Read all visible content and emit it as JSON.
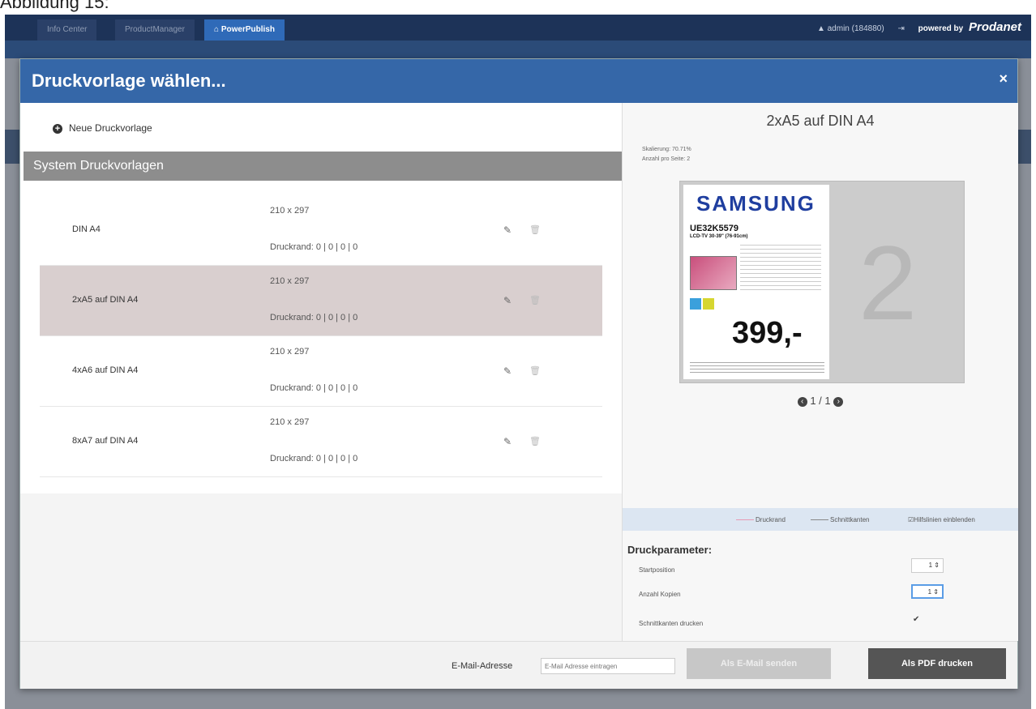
{
  "caption": "Abbildung 15:",
  "topbar": {
    "tabs": [
      {
        "label": "Info Center"
      },
      {
        "label": "ProductManager"
      },
      {
        "label": "PowerPublish"
      }
    ],
    "user": "admin (184880)",
    "powered_by": "powered by",
    "brand": "Prodanet"
  },
  "modal": {
    "title": "Druckvorlage wählen...",
    "close": "×",
    "new_template": "Neue Druckvorlage",
    "section_title": "System Druckvorlagen",
    "templates": [
      {
        "name": "DIN A4",
        "dimensions": "210 x 297",
        "margin": "Druckrand: 0 | 0 | 0 | 0"
      },
      {
        "name": "2xA5 auf DIN A4",
        "dimensions": "210 x 297",
        "margin": "Druckrand: 0 | 0 | 0 | 0"
      },
      {
        "name": "4xA6 auf DIN A4",
        "dimensions": "210 x 297",
        "margin": "Druckrand: 0 | 0 | 0 | 0"
      },
      {
        "name": "8xA7 auf DIN A4",
        "dimensions": "210 x 297",
        "margin": "Druckrand: 0 | 0 | 0 | 0"
      }
    ],
    "selected_index": 1
  },
  "preview": {
    "title": "2xA5 auf DIN A4",
    "scale": "Skalierung: 70.71%",
    "per_page": "Anzahl pro Seite: 2",
    "product": {
      "brand": "SAMSUNG",
      "model": "UE32K5579",
      "subtitle": "LCD-TV 30-39\" (76-91cm)",
      "price": "399,-"
    },
    "page_number": "2",
    "pager": "1 / 1"
  },
  "legend": {
    "print_margin": "Druckrand",
    "cut_marks": "Schnittkanten",
    "show_guides": "Hilfslinien einblenden"
  },
  "print_params": {
    "title": "Druckparameter:",
    "start_position_label": "Startposition",
    "start_position_value": "1",
    "copies_label": "Anzahl Kopien",
    "copies_value": "1",
    "print_cut_marks_label": "Schnittkanten drucken"
  },
  "footer": {
    "email_label": "E-Mail-Adresse",
    "email_placeholder": "E-Mail Adresse eintragen",
    "send_email": "Als E-Mail senden",
    "print_pdf": "Als PDF drucken"
  },
  "colors": {
    "header_blue": "#3567a8",
    "selected_row": "#d9cfcf",
    "section_gray": "#8d8d8d"
  }
}
